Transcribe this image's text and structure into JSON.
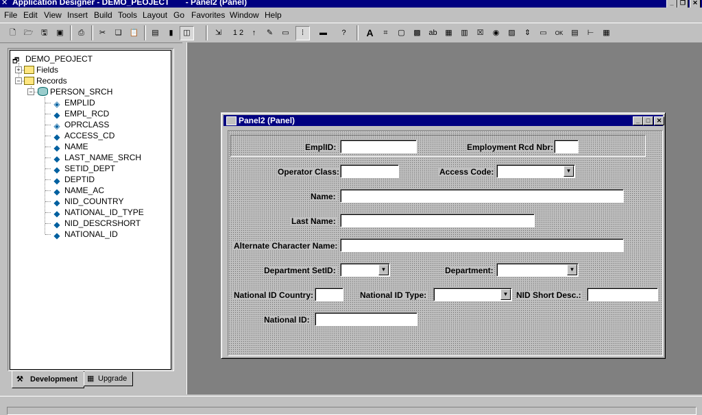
{
  "window": {
    "title": "Application Designer - DEMO_PEOJECT       - Panel2 (Panel)"
  },
  "menu": [
    "File",
    "Edit",
    "View",
    "Insert",
    "Build",
    "Tools",
    "Layout",
    "Go",
    "Favorites",
    "Window",
    "Help"
  ],
  "toolbar": {
    "label_a": "A",
    "label_ab": "ab",
    "label_ok": "OK",
    "label_12": "1 2",
    "label_help": "?"
  },
  "project": {
    "root": "DEMO_PEOJECT",
    "fields_folder": "Fields",
    "records_folder": "Records",
    "record": "PERSON_SRCH",
    "items": [
      "EMPLID",
      "EMPL_RCD",
      "OPRCLASS",
      "ACCESS_CD",
      "NAME",
      "LAST_NAME_SRCH",
      "SETID_DEPT",
      "DEPTID",
      "NAME_AC",
      "NID_COUNTRY",
      "NATIONAL_ID_TYPE",
      "NID_DESCRSHORT",
      "NATIONAL_ID"
    ],
    "tabs": {
      "development": "Development",
      "upgrade": "Upgrade"
    }
  },
  "panel": {
    "title": "Panel2 (Panel)",
    "labels": {
      "emplid": "EmplID:",
      "empl_rcd": "Employment Rcd Nbr:",
      "operator_class": "Operator Class:",
      "access_code": "Access Code:",
      "name": "Name:",
      "last_name": "Last Name:",
      "alt_char_name": "Alternate Character Name:",
      "dept_setid": "Department SetID:",
      "department": "Department:",
      "nid_country": "National ID Country:",
      "nid_type": "National ID Type:",
      "nid_short_desc": "NID Short Desc.:",
      "national_id": "National ID:"
    }
  },
  "colors": {
    "titlebar": "#000080",
    "face": "#c0c0c0",
    "workspace": "#808080"
  }
}
